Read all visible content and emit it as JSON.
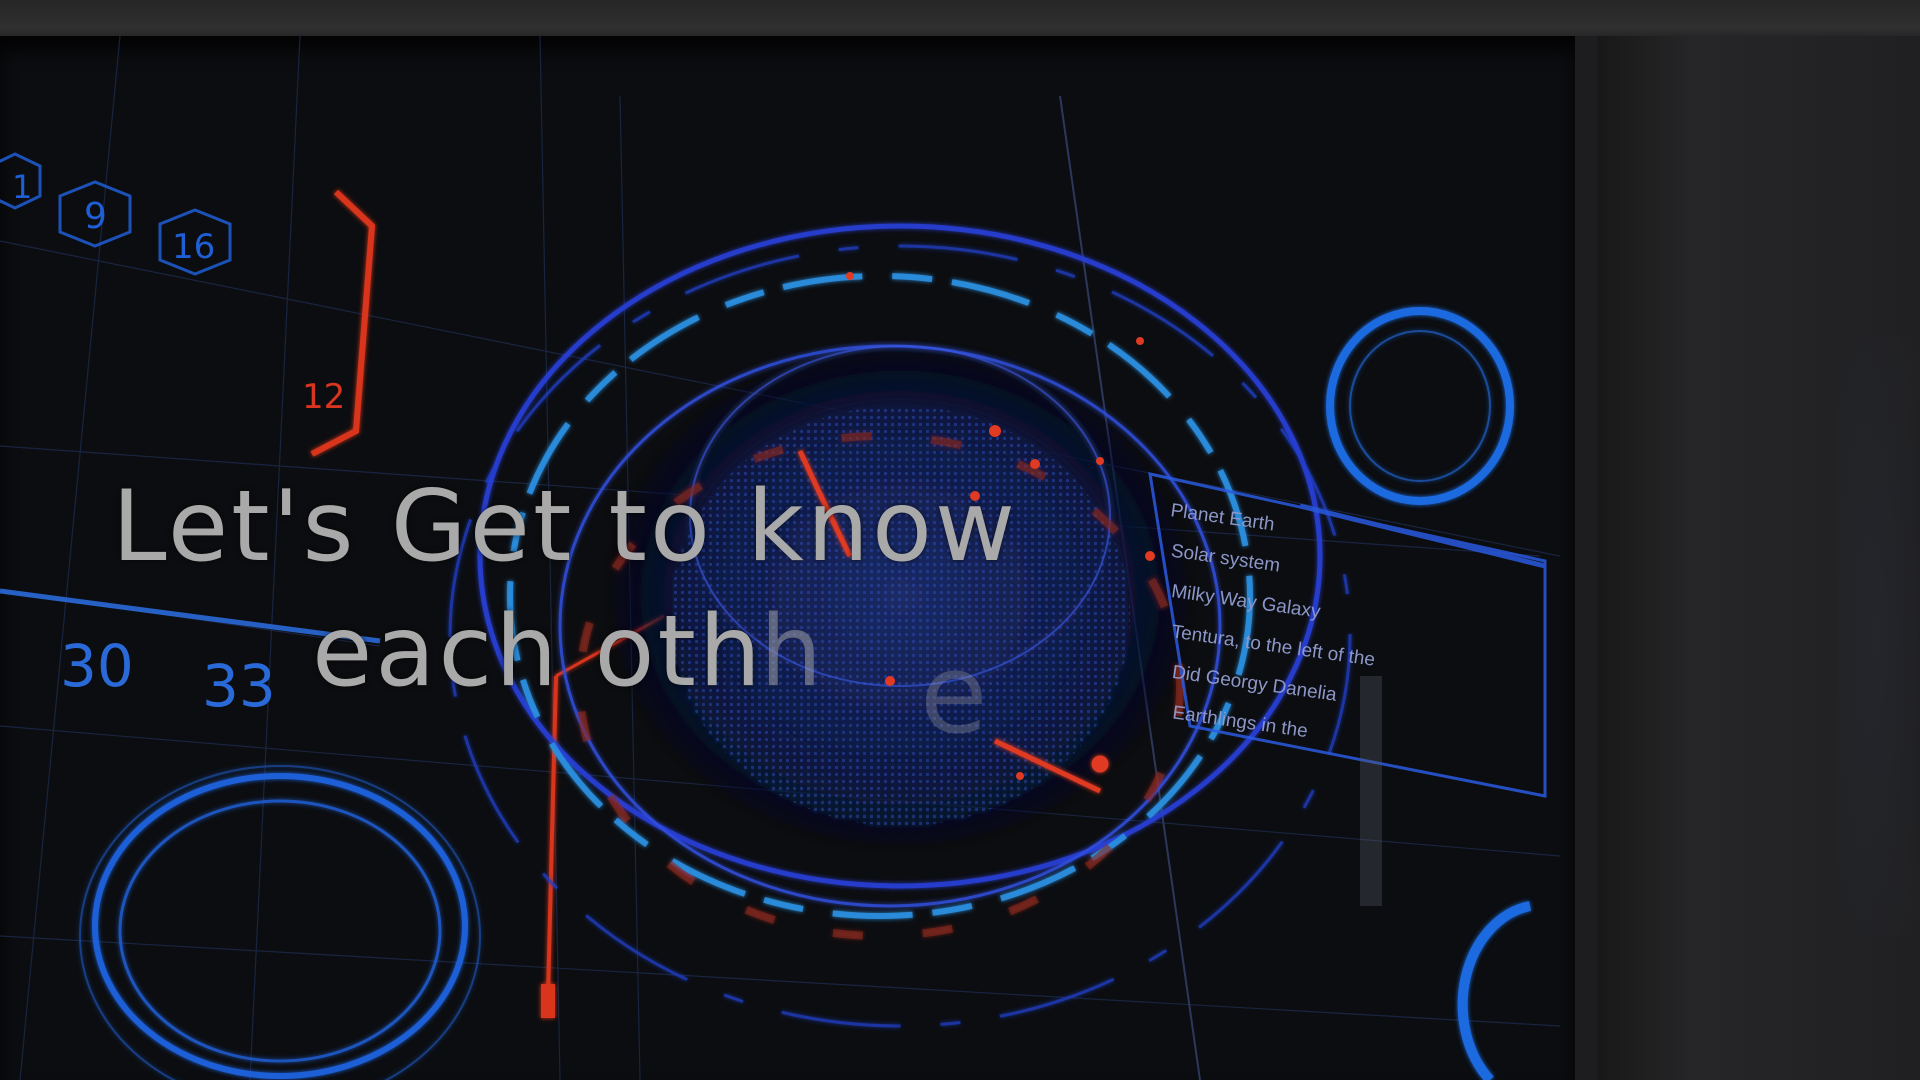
{
  "title": {
    "line1": "Let's Get to know",
    "line2": "each oth",
    "fading_letters": [
      "h",
      "e"
    ]
  },
  "hud": {
    "top_badges": [
      "1",
      "9",
      "16"
    ],
    "red_bracket_number": "12",
    "left_numbers": [
      "30",
      "33"
    ],
    "info_panel": [
      "Planet Earth",
      "Solar system",
      "Milky Way Galaxy",
      "Tentura, to the left of the",
      "Did Georgy Danelia",
      "Earthlings in the"
    ]
  },
  "colors": {
    "hud_blue": "#1f5fd6",
    "hud_cyan": "#2a8fe0",
    "hud_red": "#d8341f",
    "title_gray": "#a9a9a9"
  }
}
